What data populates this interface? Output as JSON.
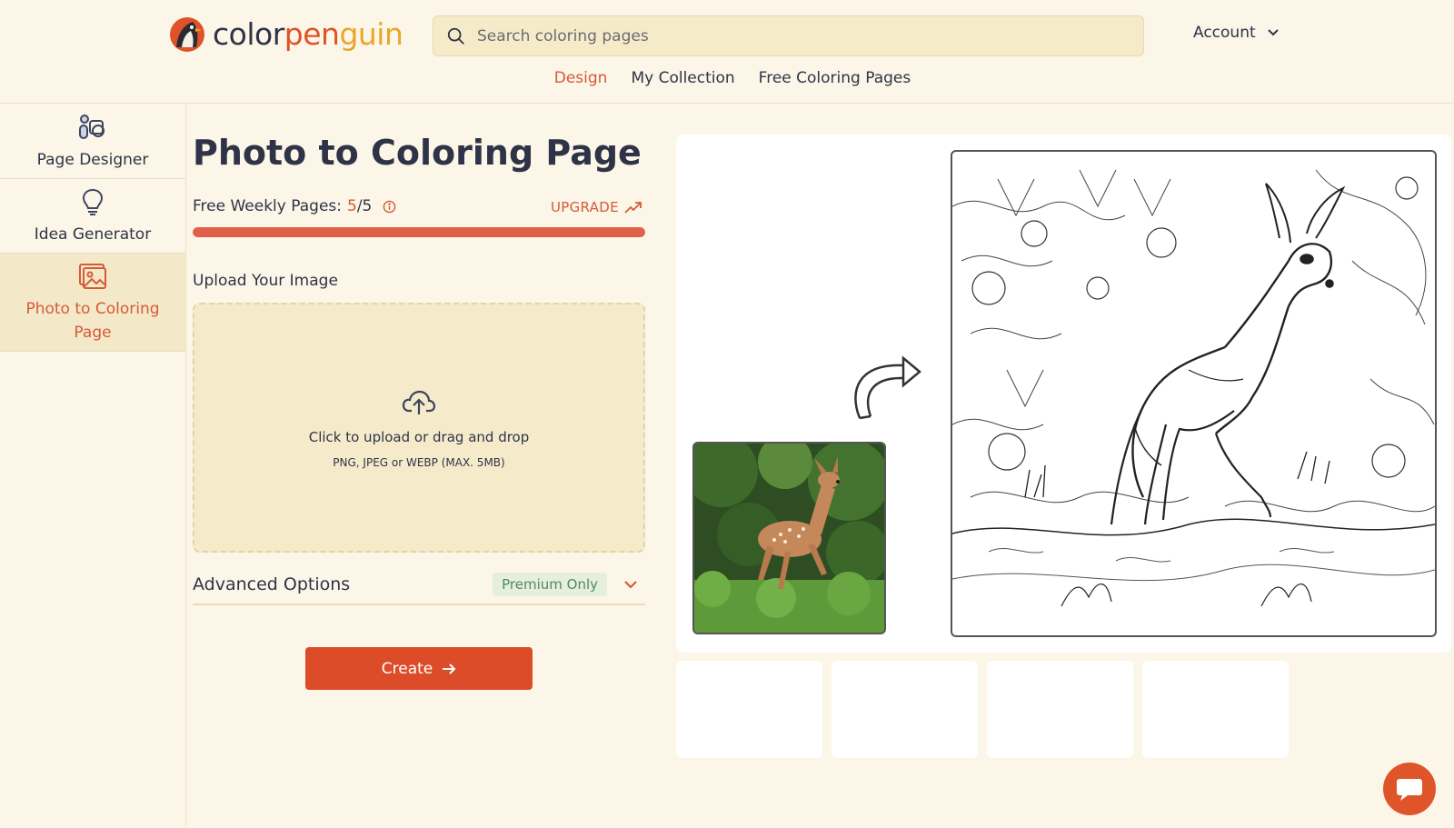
{
  "header": {
    "logo": {
      "part1": "color",
      "part2": "pen",
      "part3": "guin"
    },
    "search": {
      "placeholder": "Search coloring pages",
      "icon": "search-icon"
    },
    "account": {
      "label": "Account",
      "icon": "chevron-down-icon"
    },
    "nav": [
      {
        "label": "Design",
        "active": true
      },
      {
        "label": "My Collection",
        "active": false
      },
      {
        "label": "Free Coloring Pages",
        "active": false
      }
    ]
  },
  "sidebar": {
    "items": [
      {
        "label": "Page Designer",
        "icon": "shapes-icon",
        "active": false
      },
      {
        "label": "Idea Generator",
        "icon": "lightbulb-icon",
        "active": false
      },
      {
        "label": "Photo to Coloring Page",
        "icon": "image-icon",
        "active": true
      }
    ]
  },
  "main": {
    "title": "Photo to Coloring Page",
    "weekly": {
      "label": "Free Weekly Pages:",
      "used": "5",
      "total": "/5",
      "icon": "info-icon"
    },
    "upgrade": {
      "label": "UPGRADE",
      "icon": "trend-up-icon"
    },
    "progress_fraction": 1.0,
    "upload_label": "Upload Your Image",
    "dropzone": {
      "icon": "cloud-upload-icon",
      "line1_strong": "Click to upload",
      "line1_rest": " or drag and drop",
      "line2": "PNG, JPEG or WEBP (MAX. 5MB)"
    },
    "advanced": {
      "label": "Advanced Options",
      "badge": "Premium Only",
      "icon": "chevron-down-icon"
    },
    "create": {
      "label": "Create",
      "icon": "arrow-right-icon"
    }
  },
  "preview": {
    "photo_alt": "fawn-photo",
    "coloring_alt": "deer-line-art",
    "thumbnails_count": 4
  },
  "colors": {
    "background": "#fbf6e7",
    "accent": "#d65a38",
    "button": "#dc4c28",
    "text": "#2f3347"
  },
  "chat": {
    "icon": "chat-icon"
  }
}
